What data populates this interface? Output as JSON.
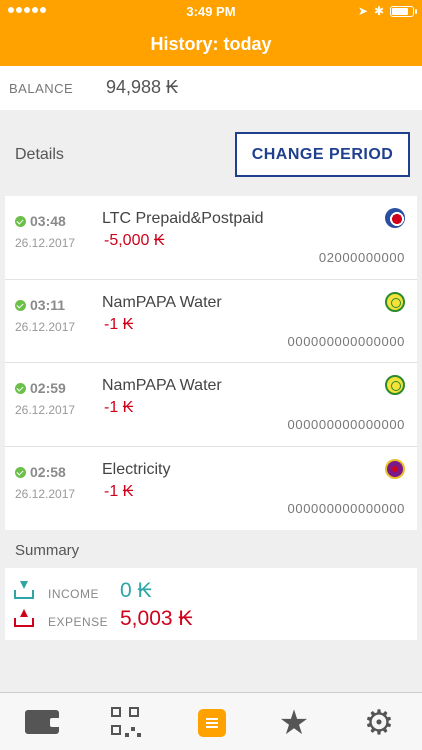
{
  "status_bar": {
    "time": "3:49 PM",
    "location_icon": "➤",
    "bluetooth_icon": "✱"
  },
  "header": {
    "title": "History: today"
  },
  "balance": {
    "label": "BALANCE",
    "value": "94,988 ₭"
  },
  "details": {
    "label": "Details",
    "change_period_label": "CHANGE PERIOD"
  },
  "transactions": [
    {
      "time": "03:48",
      "date": "26.12.2017",
      "name": "LTC Prepaid&Postpaid",
      "amount": "-5,000 ₭",
      "account": "02000000000",
      "logo": "ltc-logo-icon"
    },
    {
      "time": "03:11",
      "date": "26.12.2017",
      "name": "NamPAPA Water",
      "amount": "-1 ₭",
      "account": "000000000000000",
      "logo": "water-logo-icon"
    },
    {
      "time": "02:59",
      "date": "26.12.2017",
      "name": "NamPAPA Water",
      "amount": "-1 ₭",
      "account": "000000000000000",
      "logo": "water-logo-icon"
    },
    {
      "time": "02:58",
      "date": "26.12.2017",
      "name": "Electricity",
      "amount": "-1 ₭",
      "account": "000000000000000",
      "logo": "electricity-logo-icon"
    }
  ],
  "summary": {
    "label": "Summary",
    "income_label": "INCOME",
    "income_value": "0 ₭",
    "expense_label": "EXPENSE",
    "expense_value": "5,003 ₭"
  },
  "tab_bar": {
    "items": [
      "wallet-icon",
      "qr-code-icon",
      "history-icon",
      "favorites-star-icon",
      "settings-gear-icon"
    ],
    "active": "history-icon",
    "star_glyph": "★",
    "gear_glyph": "⚙"
  },
  "colors": {
    "accent": "#ffa200",
    "button_border": "#1f3f8f",
    "negative": "#d0021b",
    "income": "#2ea6a6"
  }
}
